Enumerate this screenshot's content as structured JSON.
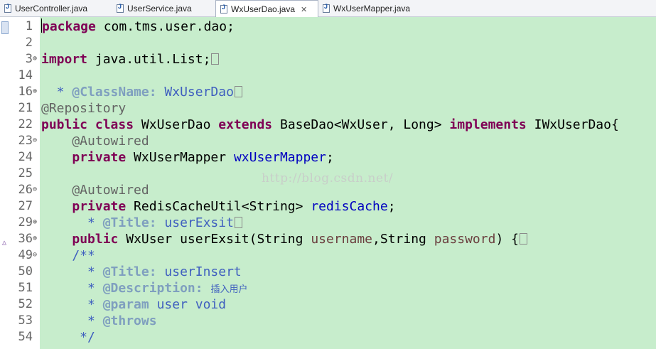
{
  "tabs": [
    {
      "label": "UserController.java",
      "active": false
    },
    {
      "label": "UserService.java",
      "active": false
    },
    {
      "label": "WxUserDao.java",
      "active": true,
      "close": "✕"
    },
    {
      "label": "WxUserMapper.java",
      "active": false
    }
  ],
  "watermark": "http://blog.csdn.net/",
  "lines": [
    {
      "num": "1",
      "fold": "",
      "tokens": [
        {
          "t": "package",
          "c": "kw"
        },
        {
          "t": " com.tms.user.dao;",
          "c": ""
        }
      ]
    },
    {
      "num": "2",
      "fold": "",
      "tokens": []
    },
    {
      "num": "3",
      "fold": "+",
      "tokens": [
        {
          "t": "import",
          "c": "kw"
        },
        {
          "t": " java.util.List;",
          "c": ""
        }
      ]
    },
    {
      "num": "14",
      "fold": "",
      "tokens": []
    },
    {
      "num": "16",
      "fold": "+",
      "tokens": [
        {
          "t": "  * ",
          "c": "doc"
        },
        {
          "t": "@ClassName:",
          "c": "doctag"
        },
        {
          "t": " WxUserDao",
          "c": "doc"
        }
      ]
    },
    {
      "num": "21",
      "fold": "",
      "tokens": [
        {
          "t": "@Repository",
          "c": "ann"
        }
      ]
    },
    {
      "num": "22",
      "fold": "",
      "tokens": [
        {
          "t": "public",
          "c": "kw"
        },
        {
          "t": " ",
          "c": ""
        },
        {
          "t": "class",
          "c": "kw"
        },
        {
          "t": " WxUserDao ",
          "c": ""
        },
        {
          "t": "extends",
          "c": "kw"
        },
        {
          "t": " BaseDao<WxUser, Long> ",
          "c": ""
        },
        {
          "t": "implements",
          "c": "kw"
        },
        {
          "t": " IWxUserDao{",
          "c": ""
        }
      ]
    },
    {
      "num": "23",
      "fold": "-",
      "tokens": [
        {
          "t": "    @Autowired",
          "c": "ann"
        }
      ]
    },
    {
      "num": "24",
      "fold": "",
      "tokens": [
        {
          "t": "    ",
          "c": ""
        },
        {
          "t": "private",
          "c": "kw"
        },
        {
          "t": " WxUserMapper ",
          "c": ""
        },
        {
          "t": "wxUserMapper",
          "c": "fld"
        },
        {
          "t": ";",
          "c": ""
        }
      ]
    },
    {
      "num": "25",
      "fold": "",
      "tokens": []
    },
    {
      "num": "26",
      "fold": "-",
      "tokens": [
        {
          "t": "    @Autowired",
          "c": "ann"
        }
      ]
    },
    {
      "num": "27",
      "fold": "",
      "tokens": [
        {
          "t": "    ",
          "c": ""
        },
        {
          "t": "private",
          "c": "kw"
        },
        {
          "t": " RedisCacheUtil<String> ",
          "c": ""
        },
        {
          "t": "redisCache",
          "c": "fld"
        },
        {
          "t": ";",
          "c": ""
        }
      ]
    },
    {
      "num": "29",
      "fold": "+",
      "tokens": [
        {
          "t": "      * ",
          "c": "doc"
        },
        {
          "t": "@Title:",
          "c": "doctag"
        },
        {
          "t": " userExsit",
          "c": "doc"
        }
      ]
    },
    {
      "num": "36",
      "fold": "+",
      "tokens": [
        {
          "t": "    ",
          "c": ""
        },
        {
          "t": "public",
          "c": "kw"
        },
        {
          "t": " WxUser userExsit(String ",
          "c": ""
        },
        {
          "t": "username",
          "c": "param"
        },
        {
          "t": ",String ",
          "c": ""
        },
        {
          "t": "password",
          "c": "param"
        },
        {
          "t": ") {",
          "c": ""
        }
      ]
    },
    {
      "num": "49",
      "fold": "-",
      "tokens": [
        {
          "t": "    /**",
          "c": "doc"
        }
      ]
    },
    {
      "num": "50",
      "fold": "",
      "tokens": [
        {
          "t": "      * ",
          "c": "doc"
        },
        {
          "t": "@Title:",
          "c": "doctag"
        },
        {
          "t": " userInsert",
          "c": "doc"
        }
      ]
    },
    {
      "num": "51",
      "fold": "",
      "tokens": [
        {
          "t": "      * ",
          "c": "doc"
        },
        {
          "t": "@Description:",
          "c": "doctag"
        },
        {
          "t": " ",
          "c": "doc"
        },
        {
          "t": "插入用户",
          "c": "cjk"
        }
      ]
    },
    {
      "num": "52",
      "fold": "",
      "tokens": [
        {
          "t": "      * ",
          "c": "doc"
        },
        {
          "t": "@param",
          "c": "doctag"
        },
        {
          "t": " user void",
          "c": "doc"
        }
      ]
    },
    {
      "num": "53",
      "fold": "",
      "tokens": [
        {
          "t": "      * ",
          "c": "doc"
        },
        {
          "t": "@throws",
          "c": "doctag"
        }
      ]
    },
    {
      "num": "54",
      "fold": "",
      "tokens": [
        {
          "t": "     */",
          "c": "doc"
        }
      ]
    }
  ]
}
